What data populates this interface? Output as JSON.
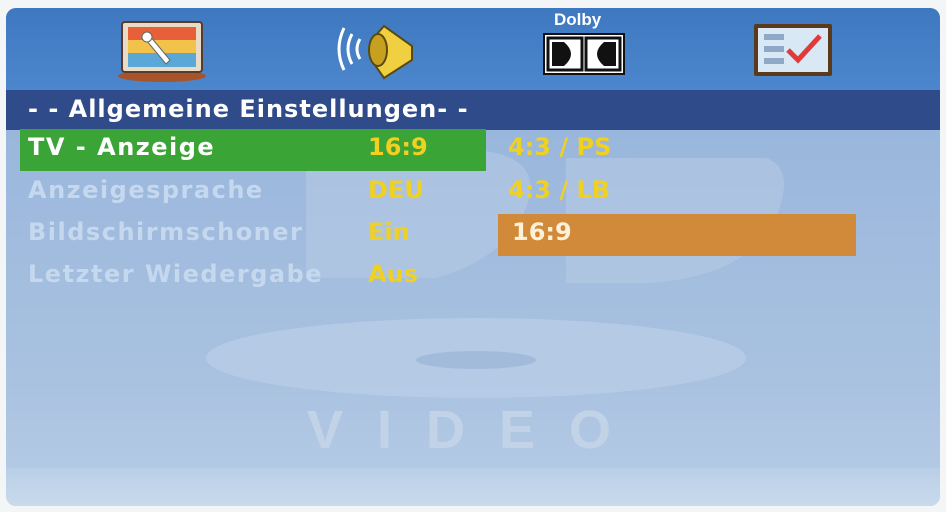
{
  "icons": [
    "settings-screen-icon",
    "speaker-icon",
    "dolby-icon",
    "preferences-icon"
  ],
  "dolby_logo_text": "Dolby",
  "header": {
    "title": "- - Allgemeine  Einstellungen- -"
  },
  "menu": {
    "items": [
      {
        "label": "TV - Anzeige",
        "value": "16:9"
      },
      {
        "label": "Anzeigesprache",
        "value": "DEU"
      },
      {
        "label": "Bildschirmschoner",
        "value": "Ein"
      },
      {
        "label": "Letzter  Wiedergabe",
        "value": "Aus"
      }
    ]
  },
  "options": [
    {
      "label": "4:3 / PS"
    },
    {
      "label": "4:3 / LB"
    },
    {
      "label": "16:9"
    }
  ],
  "watermark": {
    "text": "VIDEO"
  },
  "colors": {
    "header_bg": "#2f4b8a",
    "selected_row": "#3aa437",
    "selected_option": "#d08a3a",
    "value_text": "#f0d020"
  }
}
